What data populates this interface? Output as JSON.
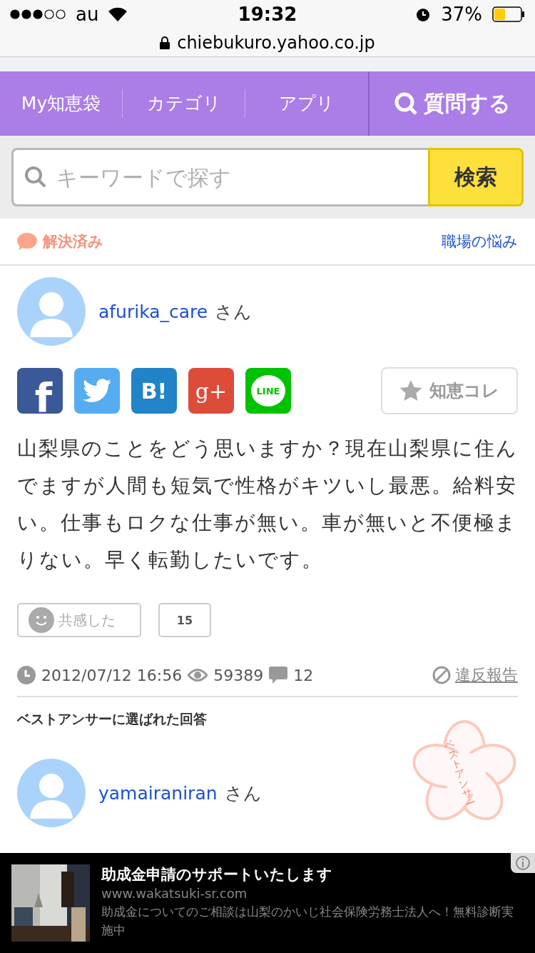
{
  "status_bar": {
    "carrier": "au",
    "time": "19:32",
    "battery": "37%"
  },
  "url": "chiebukuro.yahoo.co.jp",
  "nav": {
    "items": [
      "My知恵袋",
      "カテゴリ",
      "アプリ"
    ],
    "ask_button": "質問する"
  },
  "search": {
    "placeholder": "キーワードで探す",
    "button": "検索"
  },
  "question_header": {
    "status": "解決済み",
    "category": "職場の悩み"
  },
  "question": {
    "user": "afurika_care",
    "honorific": "さん",
    "share": [
      {
        "kind": "facebook",
        "glyph": "f"
      },
      {
        "kind": "twitter"
      },
      {
        "kind": "hatena",
        "glyph": "B!"
      },
      {
        "kind": "google_plus",
        "glyph": "g+"
      },
      {
        "kind": "line",
        "glyph": "LINE"
      }
    ],
    "save_button": "知恵コレ",
    "text": "山梨県のことをどう思いますか？現在山梨県に住んでますが人間も短気で性格がキツいし最悪。給料安い。仕事もロクな仕事が無い。車が無いと不便極まりない。早く転勤したいです。",
    "empathy_button": "共感した",
    "empathy_count": "15",
    "date": "2012/07/12 16:56",
    "views": "59389",
    "answers": "12",
    "report": "違反報告"
  },
  "best_answer": {
    "heading": "ベストアンサーに選ばれた回答",
    "stamp": "ベストアンサー",
    "user": "yamairaniran",
    "honorific": "さん"
  },
  "ad": {
    "title": "助成金申請のサポートいたします",
    "url": "www.wakatsuki-sr.com",
    "description": "助成金についてのご相談は山梨のかいじ社会保険労務士法人へ！無料診断実施中"
  }
}
